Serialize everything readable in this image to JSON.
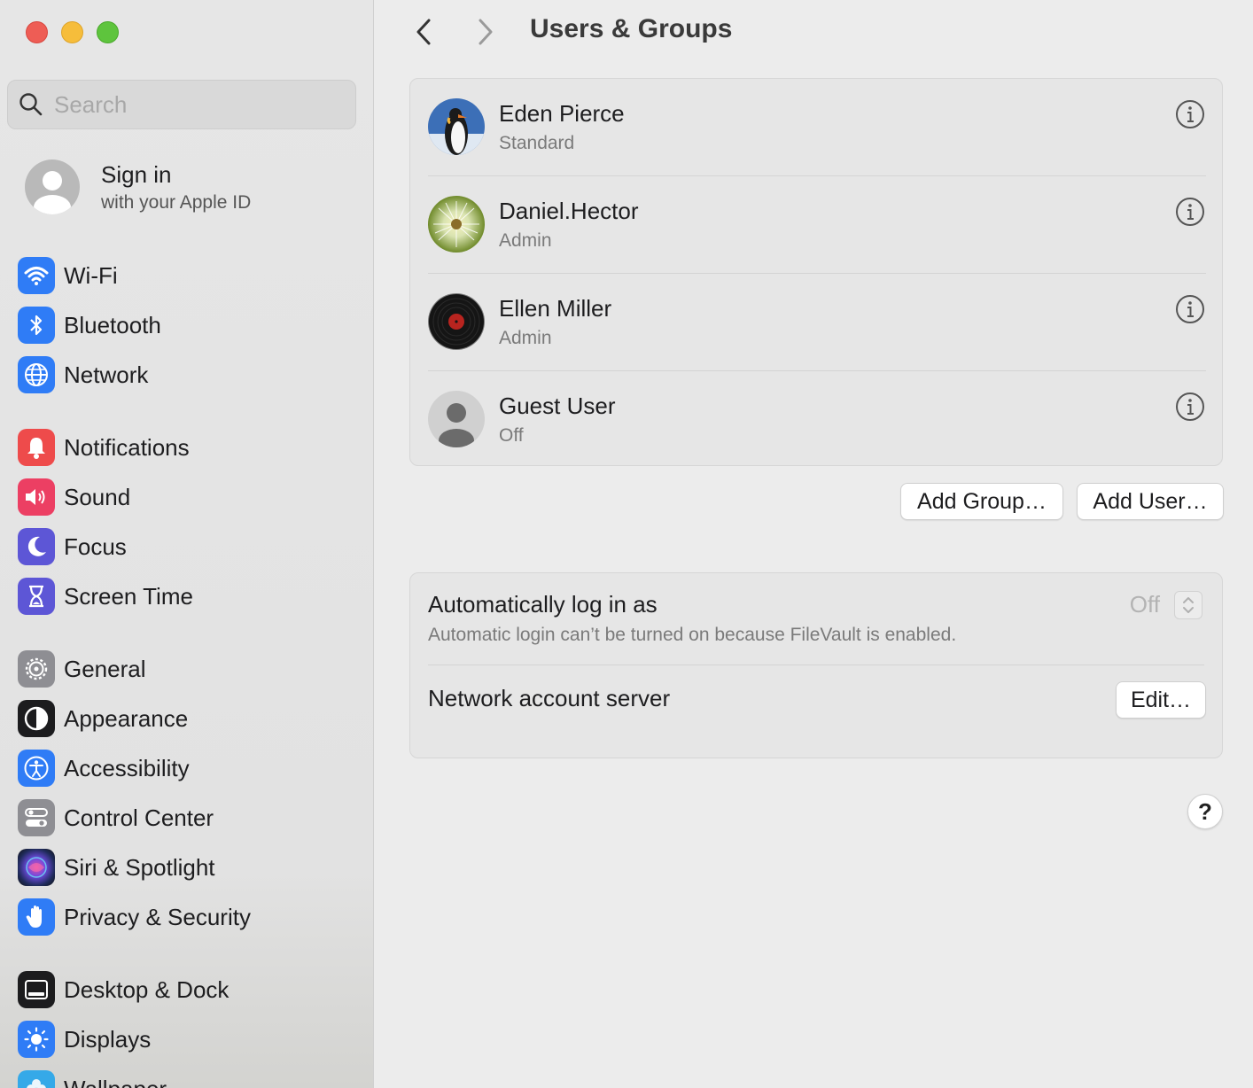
{
  "window": {
    "title": "Users & Groups"
  },
  "sidebar": {
    "search_placeholder": "Search",
    "signin": {
      "title": "Sign in",
      "subtitle": "with your Apple ID"
    },
    "items": [
      {
        "label": "Wi-Fi",
        "icon": "wifi-icon",
        "color": "#2f7cf6"
      },
      {
        "label": "Bluetooth",
        "icon": "bluetooth-icon",
        "color": "#2f7cf6"
      },
      {
        "label": "Network",
        "icon": "globe-icon",
        "color": "#2f7cf6"
      },
      {
        "label": "Notifications",
        "icon": "bell-icon",
        "color": "#ee4b4b"
      },
      {
        "label": "Sound",
        "icon": "speaker-icon",
        "color": "#ec3f63"
      },
      {
        "label": "Focus",
        "icon": "moon-icon",
        "color": "#5d56d6"
      },
      {
        "label": "Screen Time",
        "icon": "hourglass-icon",
        "color": "#5d56d6"
      },
      {
        "label": "General",
        "icon": "gear-icon",
        "color": "#8e8e93"
      },
      {
        "label": "Appearance",
        "icon": "appearance-icon",
        "color": "#1c1c1e"
      },
      {
        "label": "Accessibility",
        "icon": "accessibility-icon",
        "color": "#2f7cf6"
      },
      {
        "label": "Control Center",
        "icon": "toggles-icon",
        "color": "#8e8e93"
      },
      {
        "label": "Siri & Spotlight",
        "icon": "siri-icon",
        "color": "#222244"
      },
      {
        "label": "Privacy & Security",
        "icon": "hand-icon",
        "color": "#2f7cf6"
      },
      {
        "label": "Desktop & Dock",
        "icon": "dock-icon",
        "color": "#1c1c1e"
      },
      {
        "label": "Displays",
        "icon": "sun-icon",
        "color": "#2f7cf6"
      },
      {
        "label": "Wallpaper",
        "icon": "flower-icon",
        "color": "#35a9e8"
      }
    ]
  },
  "header": {
    "title": "Users & Groups"
  },
  "users": [
    {
      "name": "Eden Pierce",
      "role": "Standard",
      "avatar": "penguin"
    },
    {
      "name": "Daniel.Hector",
      "role": "Admin",
      "avatar": "dandelion"
    },
    {
      "name": "Ellen Miller",
      "role": "Admin",
      "avatar": "vinyl-record"
    },
    {
      "name": "Guest User",
      "role": "Off",
      "avatar": "generic"
    }
  ],
  "buttons": {
    "add_group": "Add Group…",
    "add_user": "Add User…",
    "edit": "Edit…",
    "help": "?"
  },
  "login": {
    "title": "Automatically log in as",
    "subtitle": "Automatic login can’t be turned on because FileVault is enabled.",
    "value": "Off",
    "server_label": "Network account server"
  }
}
